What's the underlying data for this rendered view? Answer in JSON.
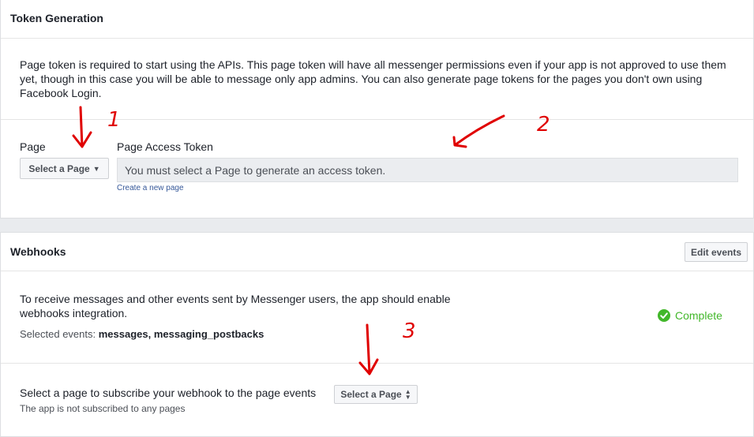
{
  "token_generation": {
    "title": "Token Generation",
    "description": "Page token is required to start using the APIs. This page token will have all messenger permissions even if your app is not approved to use them yet, though in this case you will be able to message only app admins. You can also generate page tokens for the pages you don't own using Facebook Login.",
    "page_label": "Page",
    "select_page_button": "Select a Page",
    "token_label": "Page Access Token",
    "token_placeholder": "You must select a Page to generate an access token.",
    "create_page_link": "Create a new page"
  },
  "webhooks": {
    "title": "Webhooks",
    "edit_events_button": "Edit events",
    "description": "To receive messages and other events sent by Messenger users, the app should enable webhooks integration.",
    "selected_events_label": "Selected events:",
    "selected_events_value": "messages, messaging_postbacks",
    "status": "Complete",
    "status_color": "#42b72a",
    "subscribe_text": "Select a page to subscribe your webhook to the page events",
    "select_page_button": "Select a Page",
    "subscription_status": "The app is not subscribed to any pages"
  },
  "annotations": {
    "color": "#e00000",
    "labels": [
      "1",
      "2",
      "3"
    ]
  }
}
